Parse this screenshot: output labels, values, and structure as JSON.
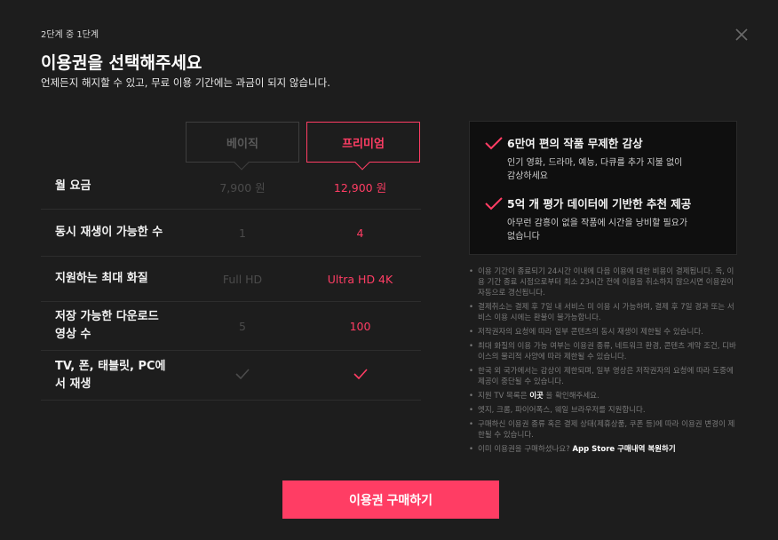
{
  "header": {
    "step": "2단계 중 1단계",
    "title": "이용권을 선택해주세요",
    "subtitle": "언제든지 해지할 수 있고, 무료 이용 기간에는 과금이 되지 않습니다."
  },
  "plans": {
    "basic": "베이직",
    "premium": "프리미엄"
  },
  "rows": [
    {
      "label": "월 요금",
      "basic": "7,900 원",
      "premium": "12,900 원"
    },
    {
      "label": "동시 재생이 가능한 수",
      "basic": "1",
      "premium": "4"
    },
    {
      "label": "지원하는 최대 화질",
      "basic": "Full HD",
      "premium": "Ultra HD 4K"
    },
    {
      "label": "저장 가능한 다운로드\n영상 수",
      "basic": "5",
      "premium": "100"
    },
    {
      "label": "TV, 폰, 태블릿, PC에\n서 재생",
      "basic": "",
      "premium": ""
    }
  ],
  "features": [
    {
      "title": "6만여 편의 작품 무제한 감상",
      "desc": "인기 영화, 드라마, 예능, 다큐를 추가 지불 없이\n감상하세요"
    },
    {
      "title": "5억 개 평가 데이터에 기반한 추천 제공",
      "desc": "아무런 감흥이 없을 작품에 시간을 낭비할 필요가\n없습니다"
    }
  ],
  "notes": [
    "이용 기간이 종료되기 24시간 이내에 다음 이용에 대한 비용이 결제됩니다. 즉, 이용 기간 종료 시점으로부터 최소 23시간 전에 이용을 취소하지 않으시면 이용권이 자동으로 갱신됩니다.",
    "결제취소는 결제 후 7일 내 서비스 미 이용 시 가능하며, 결제 후 7일 경과 또는 서비스 이용 시에는 환불이 불가능합니다.",
    "저작권자의 요청에 따라 일부 콘텐츠의 동시 재생이 제한될 수 있습니다.",
    "최대 화질의 이용 가능 여부는 이용권 종류, 네트워크 환경, 콘텐츠 계약 조건, 디바이스의 물리적 사양에 따라 제한될 수 있습니다.",
    "한국 외 국가에서는 감상이 제한되며, 일부 영상은 저작권자의 요청에 따라 도중에 제공이 중단될 수 있습니다."
  ],
  "note_tv": {
    "pre": "지원 TV 목록은 ",
    "link": "이곳",
    "post": " 을 확인해주세요."
  },
  "notes2": [
    "엣지, 크롬, 파이어폭스, 웨일 브라우저를 지원합니다.",
    "구매하신 이용권 종류 혹은 결제 상태(제휴상품, 쿠폰 등)에 따라 이용권 변경이 제한될 수 있습니다."
  ],
  "note_restore": {
    "pre": "이미 이용권을 구매하셨나요? ",
    "link": "App Store 구매내역 복원하기"
  },
  "buy_button": "이용권 구매하기",
  "colors": {
    "accent": "#ff3d64",
    "background": "#1d1d1d"
  },
  "icons": {
    "close": "close-icon",
    "check": "check-icon"
  }
}
